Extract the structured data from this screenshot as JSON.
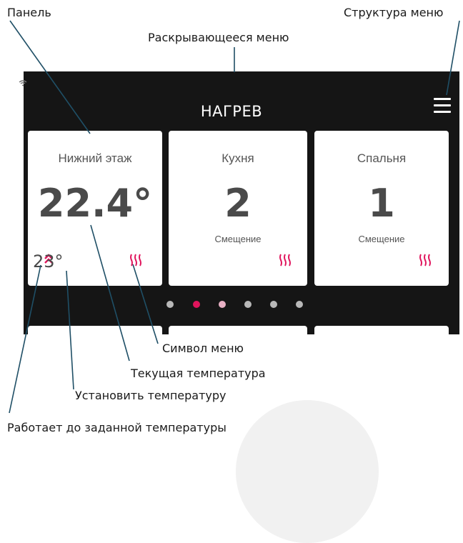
{
  "labels": {
    "panel": "Панель",
    "menu_structure": "Структура меню",
    "dropdown_menu": "Раскрывающееся меню",
    "menu_symbol": "Символ меню",
    "current_temperature": "Текущая температура",
    "set_temperature": "Установить температуру",
    "works_to_target": "Работает до заданной температуры"
  },
  "screen": {
    "title": "НАГРЕВ",
    "cards": [
      {
        "title": "Нижний этаж",
        "value": "22.4°",
        "setpoint": "23°"
      },
      {
        "title": "Кухня",
        "value": "2",
        "subtitle": "Смещение"
      },
      {
        "title": "Спальня",
        "value": "1",
        "subtitle": "Смещение"
      }
    ],
    "page_dots": 6,
    "active_dot": 2
  },
  "colors": {
    "screen_bg": "#151515",
    "accent": "#e0145c",
    "card_bg": "#ffffff"
  },
  "icons": [
    "wifi-icon",
    "hamburger-menu-icon",
    "heat-wave-icon",
    "chevron-up-icon"
  ]
}
